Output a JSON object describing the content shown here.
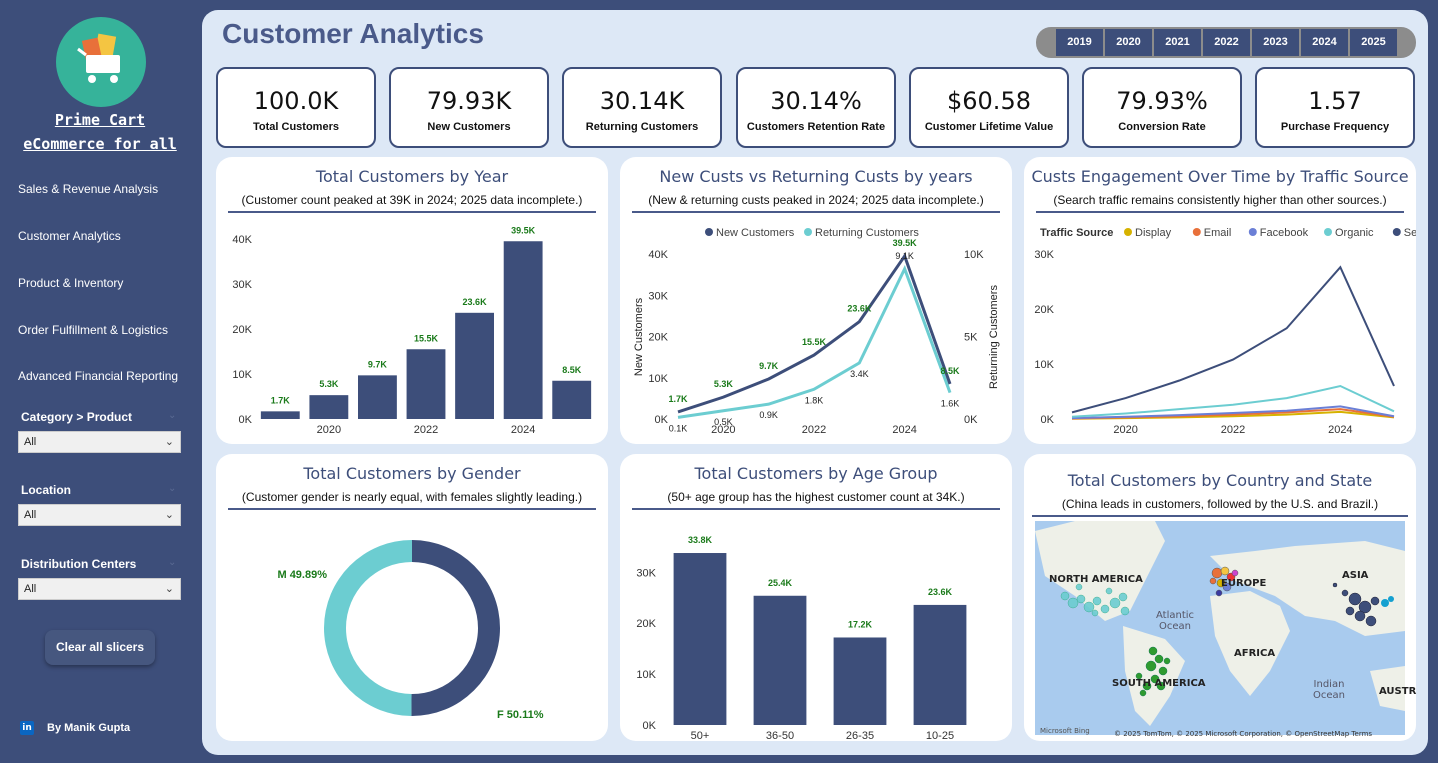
{
  "sidebar": {
    "brand_line1": "Prime Cart",
    "brand_line2": "eCommerce for all",
    "nav": [
      "Sales & Revenue Analysis",
      "Customer Analytics",
      "Product & Inventory",
      "Order Fulfillment & Logistics",
      "Advanced Financial Reporting"
    ],
    "slicers": [
      {
        "label": "Category > Product",
        "value": "All"
      },
      {
        "label": "Location",
        "value": "All"
      },
      {
        "label": "Distribution Centers",
        "value": "All"
      }
    ],
    "clear_label": "Clear all slicers",
    "author": "By Manik Gupta"
  },
  "header": {
    "title": "Customer Analytics",
    "years": [
      "2019",
      "2020",
      "2021",
      "2022",
      "2023",
      "2024",
      "2025"
    ]
  },
  "kpis": [
    {
      "value": "100.0K",
      "label": "Total Customers"
    },
    {
      "value": "79.93K",
      "label": "New Customers"
    },
    {
      "value": "30.14K",
      "label": "Returning Customers"
    },
    {
      "value": "30.14%",
      "label": "Customers Retention Rate"
    },
    {
      "value": "$60.58",
      "label": "Customer Lifetime Value"
    },
    {
      "value": "79.93%",
      "label": "Conversion Rate"
    },
    {
      "value": "1.57",
      "label": "Purchase Frequency"
    }
  ],
  "cards": {
    "year": {
      "title": "Total Customers by Year",
      "subtitle": "(Customer count peaked at 39K in 2024; 2025 data incomplete.)"
    },
    "newret": {
      "title": "New Custs vs Returning Custs by years",
      "subtitle": "(New & returning custs peaked in 2024; 2025 data incomplete.)"
    },
    "traffic": {
      "title": "Custs Engagement Over Time by Traffic Source",
      "subtitle": "(Search traffic remains consistently higher than other sources.)"
    },
    "gender": {
      "title": "Total Customers by Gender",
      "subtitle": "(Customer gender is nearly equal, with females slightly leading.)"
    },
    "age": {
      "title": "Total Customers by Age Group",
      "subtitle": "(50+ age group has the highest customer count at 34K.)"
    },
    "map": {
      "title": "Total Customers by Country and State",
      "subtitle": "(China leads in customers, followed by the U.S. and Brazil.)",
      "labels": [
        "NORTH AMERICA",
        "EUROPE",
        "ASIA",
        "Atlantic Ocean",
        "AFRICA",
        "SOUTH AMERICA",
        "Indian Ocean",
        "AUSTR"
      ],
      "bing": "Microsoft Bing",
      "credit": "© 2025 TomTom, © 2025 Microsoft Corporation, © OpenStreetMap  Terms"
    }
  },
  "chart_data": [
    {
      "type": "bar",
      "title": "Total Customers by Year",
      "categories": [
        2019,
        2020,
        2021,
        2022,
        2023,
        2024,
        2025
      ],
      "values": [
        1.7,
        5.3,
        9.7,
        15.5,
        23.6,
        39.5,
        8.5
      ],
      "data_labels": [
        "1.7K",
        "5.3K",
        "9.7K",
        "15.5K",
        "23.6K",
        "39.5K",
        "8.5K"
      ],
      "x_ticks": [
        "2020",
        "2022",
        "2024"
      ],
      "y_ticks": [
        "0K",
        "10K",
        "20K",
        "30K",
        "40K"
      ],
      "ylim": [
        0,
        40
      ],
      "color": "#3d4e7a"
    },
    {
      "type": "line",
      "title": "New Custs vs Returning Custs by years",
      "x": [
        2019,
        2020,
        2021,
        2022,
        2023,
        2024,
        2025
      ],
      "x_ticks": [
        "2020",
        "2022",
        "2024"
      ],
      "legend": [
        "New Customers",
        "Returning Customers"
      ],
      "series": [
        {
          "name": "New Customers",
          "axis": "left",
          "values": [
            1.7,
            5.3,
            9.7,
            15.5,
            23.6,
            39.5,
            8.5
          ],
          "labels": [
            "1.7K",
            "5.3K",
            "9.7K",
            "15.5K",
            "23.6K",
            "39.5K",
            "8.5K"
          ],
          "color": "#3d4e7a"
        },
        {
          "name": "Returning Customers",
          "axis": "right",
          "values": [
            0.1,
            0.5,
            0.9,
            1.8,
            3.4,
            9.1,
            1.6
          ],
          "labels": [
            "0.1K",
            "0.5K",
            "0.9K",
            "1.8K",
            "3.4K",
            "9.1K",
            "1.6K"
          ],
          "color": "#6ccdd1"
        }
      ],
      "ylabel_left": "New Customers",
      "ylabel_right": "Returning Customers",
      "yticks_left": [
        "0K",
        "10K",
        "20K",
        "30K",
        "40K"
      ],
      "yticks_right": [
        "0K",
        "5K",
        "10K"
      ],
      "ylim_left": [
        0,
        40
      ],
      "ylim_right": [
        0,
        10
      ]
    },
    {
      "type": "line",
      "title": "Custs Engagement Over Time by Traffic Source",
      "x": [
        2019,
        2020,
        2021,
        2022,
        2023,
        2024,
        2025
      ],
      "x_ticks": [
        "2020",
        "2022",
        "2024"
      ],
      "y_ticks": [
        "0K",
        "10K",
        "20K",
        "30K"
      ],
      "ylim": [
        0,
        30
      ],
      "legend_title": "Traffic Source",
      "series": [
        {
          "name": "Display",
          "values": [
            0.05,
            0.15,
            0.3,
            0.5,
            0.8,
            1.3,
            0.3
          ],
          "color": "#d6b200"
        },
        {
          "name": "Email",
          "values": [
            0.1,
            0.3,
            0.5,
            0.8,
            1.2,
            1.8,
            0.4
          ],
          "color": "#e8703a"
        },
        {
          "name": "Facebook",
          "values": [
            0.15,
            0.4,
            0.7,
            1.1,
            1.5,
            2.3,
            0.5
          ],
          "color": "#6b7fd6"
        },
        {
          "name": "Organic",
          "values": [
            0.4,
            1.0,
            1.8,
            2.6,
            3.8,
            6.0,
            1.4
          ],
          "color": "#6ccdd1"
        },
        {
          "name": "Search",
          "values": [
            1.2,
            3.8,
            7.0,
            10.8,
            16.5,
            27.6,
            6.0
          ],
          "color": "#3d4e7a"
        }
      ]
    },
    {
      "type": "pie",
      "title": "Total Customers by Gender",
      "categories": [
        "M",
        "F"
      ],
      "values": [
        49.89,
        50.11
      ],
      "data_labels": [
        "M 49.89%",
        "F 50.11%"
      ],
      "colors": [
        "#6ccdd1",
        "#3d4e7a"
      ]
    },
    {
      "type": "bar",
      "title": "Total Customers by Age Group",
      "categories": [
        "50+",
        "36-50",
        "26-35",
        "10-25"
      ],
      "values": [
        33.8,
        25.4,
        17.2,
        23.6
      ],
      "data_labels": [
        "33.8K",
        "25.4K",
        "17.2K",
        "23.6K"
      ],
      "y_ticks": [
        "0K",
        "10K",
        "20K",
        "30K"
      ],
      "ylim": [
        0,
        34
      ],
      "color": "#3d4e7a"
    }
  ]
}
